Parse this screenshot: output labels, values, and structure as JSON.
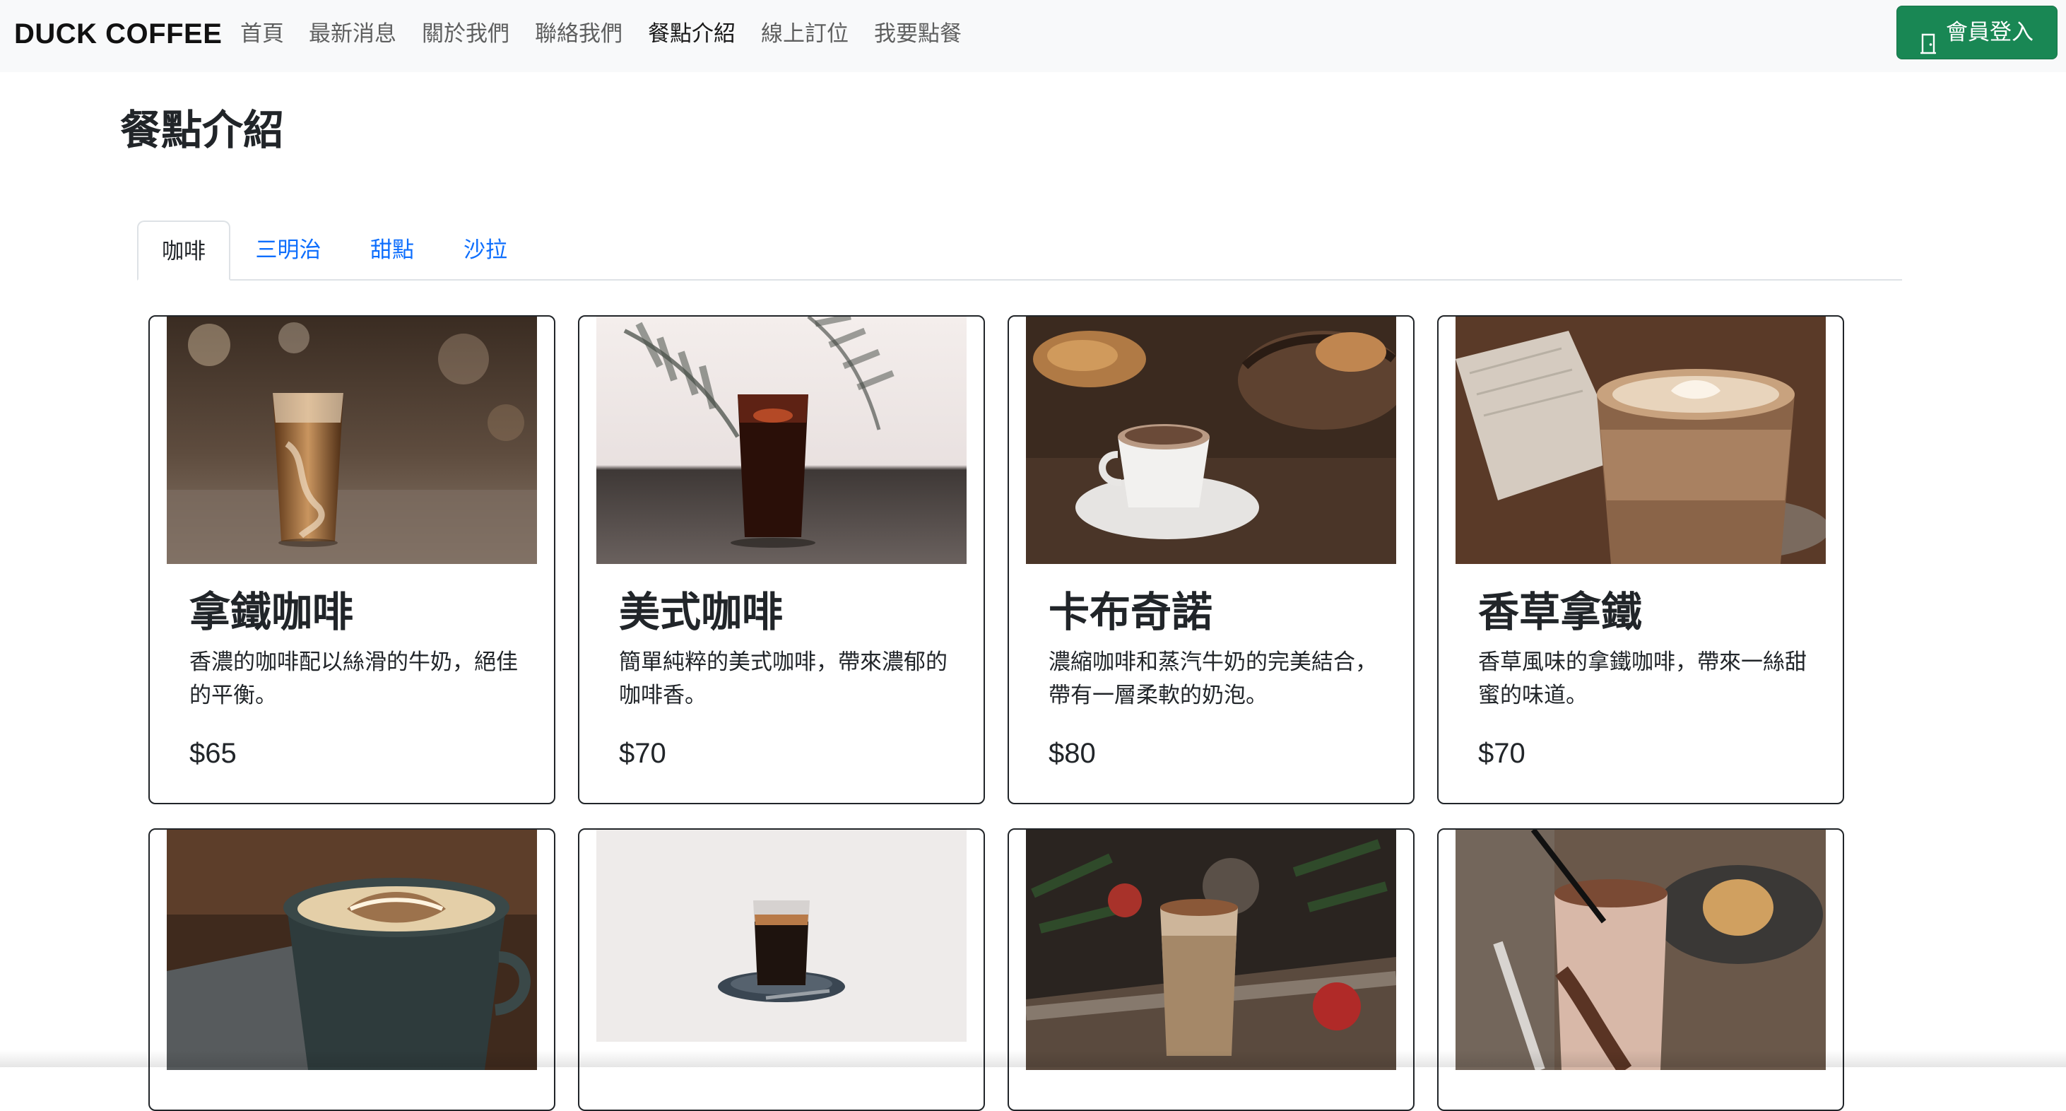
{
  "navbar": {
    "brand": "DUCK COFFEE",
    "items": [
      {
        "label": "首頁"
      },
      {
        "label": "最新消息"
      },
      {
        "label": "關於我們"
      },
      {
        "label": "聯絡我們"
      },
      {
        "label": "餐點介紹",
        "active": true
      },
      {
        "label": "線上訂位"
      },
      {
        "label": "我要點餐"
      }
    ],
    "login_label": "會員登入",
    "login_icon": "door-icon",
    "login_color": "#198754"
  },
  "page": {
    "title": "餐點介紹"
  },
  "tabs": [
    {
      "label": "咖啡",
      "active": true
    },
    {
      "label": "三明治"
    },
    {
      "label": "甜點"
    },
    {
      "label": "沙拉"
    }
  ],
  "menu": {
    "items": [
      {
        "name": "拿鐵咖啡",
        "description": "香濃的咖啡配以絲滑的牛奶，絕佳的平衡。",
        "price": "$65"
      },
      {
        "name": "美式咖啡",
        "description": "簡單純粹的美式咖啡，帶來濃郁的咖啡香。",
        "price": "$70"
      },
      {
        "name": "卡布奇諾",
        "description": "濃縮咖啡和蒸汽牛奶的完美結合，帶有一層柔軟的奶泡。",
        "price": "$80"
      },
      {
        "name": "香草拿鐵",
        "description": "香草風味的拿鐵咖啡，帶來一絲甜蜜的味道。",
        "price": "$70"
      }
    ]
  },
  "colors": {
    "link": "#0d6efd",
    "navbar_bg": "#f8f9fa",
    "card_border": "#212529"
  }
}
